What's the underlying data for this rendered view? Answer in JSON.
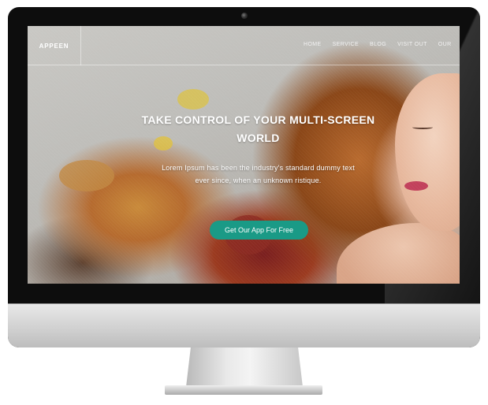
{
  "site": {
    "logo": "APPEEN"
  },
  "nav": {
    "items": [
      "HOME",
      "SERVICE",
      "BLOG",
      "VISIT OUT",
      "OUR"
    ]
  },
  "hero": {
    "title": "TAKE CONTROL OF YOUR MULTI-SCREEN WORLD",
    "text": "Lorem Ipsum has been the industry's standard dummy text ever since, when an unknown ristique.",
    "cta_label": "Get Our App For Free"
  },
  "colors": {
    "accent": "#1a9a86",
    "bezel": "#0d0d0d",
    "chin": "#cfcfcf"
  }
}
